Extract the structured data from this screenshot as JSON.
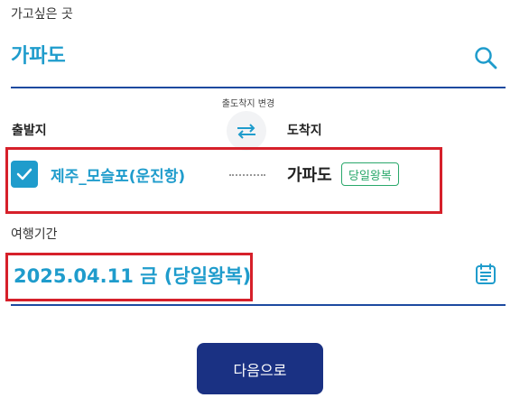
{
  "destination": {
    "label": "가고싶은 곳",
    "value": "가파도",
    "search_icon": "search-icon"
  },
  "swap": {
    "caption": "출도착지 변경",
    "icon": "swap-arrows-icon"
  },
  "route": {
    "departure_label": "출발지",
    "arrival_label": "도착지",
    "departure_checked": true,
    "departure_value": "제주_모슬포(운진항)",
    "arrival_value": "가파도",
    "trip_badge": "당일왕복"
  },
  "period": {
    "label": "여행기간",
    "value": "2025.04.11 금 (당일왕복)",
    "calendar_icon": "calendar-icon"
  },
  "next_button": {
    "label": "다음으로"
  },
  "colors": {
    "accent": "#1f9ccc",
    "underline": "#1d4aa0",
    "highlight_border": "#d6202a",
    "badge": "#2aa86b",
    "primary_button": "#1a3183"
  }
}
